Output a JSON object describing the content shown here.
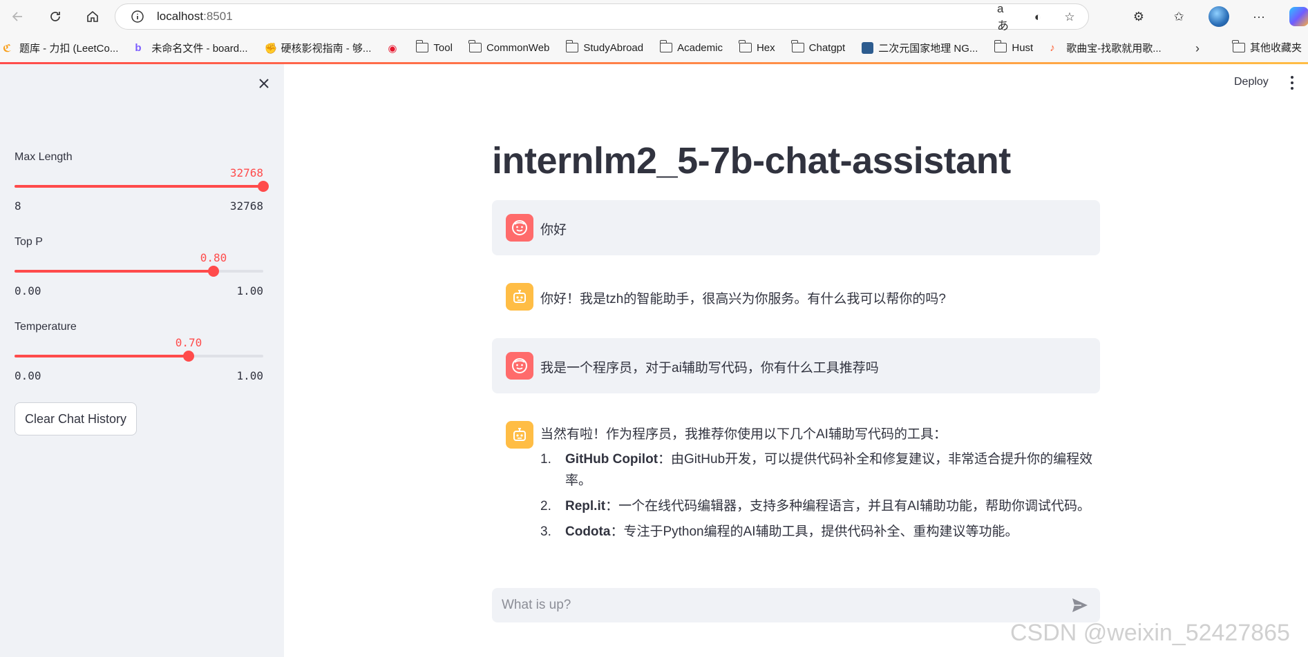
{
  "browser": {
    "url_host": "localhost",
    "url_port": ":8501",
    "bookmarks": [
      "题库 - 力扣 (LeetCo...",
      "未命名文件 - board...",
      "硬核影视指南 - 够...",
      "Tool",
      "CommonWeb",
      "StudyAbroad",
      "Academic",
      "Hex",
      "Chatgpt",
      "二次元国家地理 NG...",
      "Hust",
      "歌曲宝-找歌就用歌..."
    ],
    "other_bookmarks": "其他收藏夹"
  },
  "sidebar": {
    "max_length": {
      "label": "Max Length",
      "value": "32768",
      "min": "8",
      "max": "32768",
      "fraction": 1.0
    },
    "top_p": {
      "label": "Top P",
      "value": "0.80",
      "min": "0.00",
      "max": "1.00",
      "fraction": 0.8
    },
    "temperature": {
      "label": "Temperature",
      "value": "0.70",
      "min": "0.00",
      "max": "1.00",
      "fraction": 0.7
    },
    "clear_button": "Clear Chat History"
  },
  "header": {
    "deploy": "Deploy"
  },
  "main": {
    "title": "internlm2_5-7b-chat-assistant",
    "messages": [
      {
        "role": "user",
        "text": "你好"
      },
      {
        "role": "assistant",
        "text": "你好！我是tzh的智能助手，很高兴为你服务。有什么我可以帮你的吗?"
      },
      {
        "role": "user",
        "text": "我是一个程序员，对于ai辅助写代码，你有什么工具推荐吗"
      },
      {
        "role": "assistant",
        "text": "当然有啦！作为程序员，我推荐你使用以下几个AI辅助写代码的工具：",
        "items": [
          {
            "num": "1.",
            "name": "GitHub Copilot",
            "desc": "：由GitHub开发，可以提供代码补全和修复建议，非常适合提升你的编程效率。"
          },
          {
            "num": "2.",
            "name": "Repl.it",
            "desc": "：一个在线代码编辑器，支持多种编程语言，并且有AI辅助功能，帮助你调试代码。"
          },
          {
            "num": "3.",
            "name": "Codota",
            "desc": "：专注于Python编程的AI辅助工具，提供代码补全、重构建议等功能。"
          }
        ]
      }
    ],
    "input_placeholder": "What is up?"
  },
  "watermark": "CSDN @weixin_52427865",
  "colors": {
    "accent": "#ff4b4b",
    "user_avatar": "#ff6b6b",
    "bot_avatar": "#ffbd45",
    "sidebar_bg": "#f0f2f6"
  }
}
